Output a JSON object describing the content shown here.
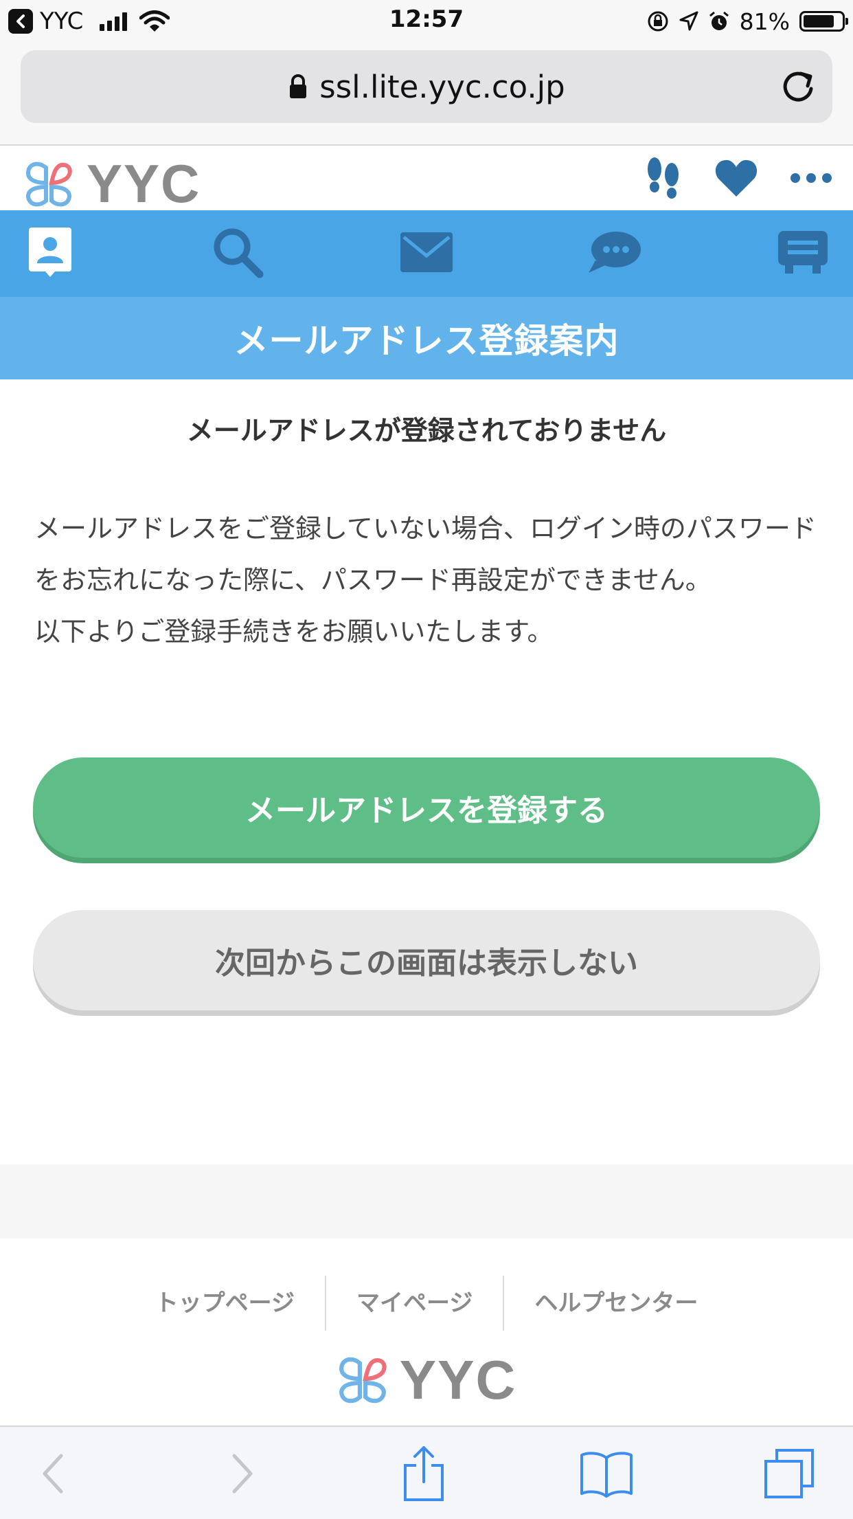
{
  "status_bar": {
    "carrier": "YYC",
    "time": "12:57",
    "battery": "81%",
    "battery_level": 0.81
  },
  "browser": {
    "url": "ssl.lite.yyc.co.jp"
  },
  "site": {
    "logo_text": "YYC",
    "header_icons": [
      "footprints-icon",
      "heart-icon",
      "more-icon"
    ],
    "nav_icons": [
      "profile-icon",
      "search-icon",
      "mail-icon",
      "chat-icon",
      "board-icon"
    ]
  },
  "page": {
    "title": "メールアドレス登録案内",
    "subheading": "メールアドレスが登録されておりません",
    "body_line1": "メールアドレスをご登録していない場合、ログイン時のパスワードをお忘れになった際に、パスワード再設定ができません。",
    "body_line2": "以下よりご登録手続きをお願いいたします。",
    "register_button": "メールアドレスを登録する",
    "dismiss_button": "次回からこの画面は表示しない"
  },
  "footer": {
    "links": [
      "トップページ",
      "マイページ",
      "ヘルプセンター"
    ],
    "logo_text": "YYC"
  },
  "colors": {
    "nav_blue": "#4aa5e6",
    "banner_blue": "#62b2ec",
    "primary_green": "#5fbe87",
    "icon_dark_blue": "#2e6fa6"
  }
}
